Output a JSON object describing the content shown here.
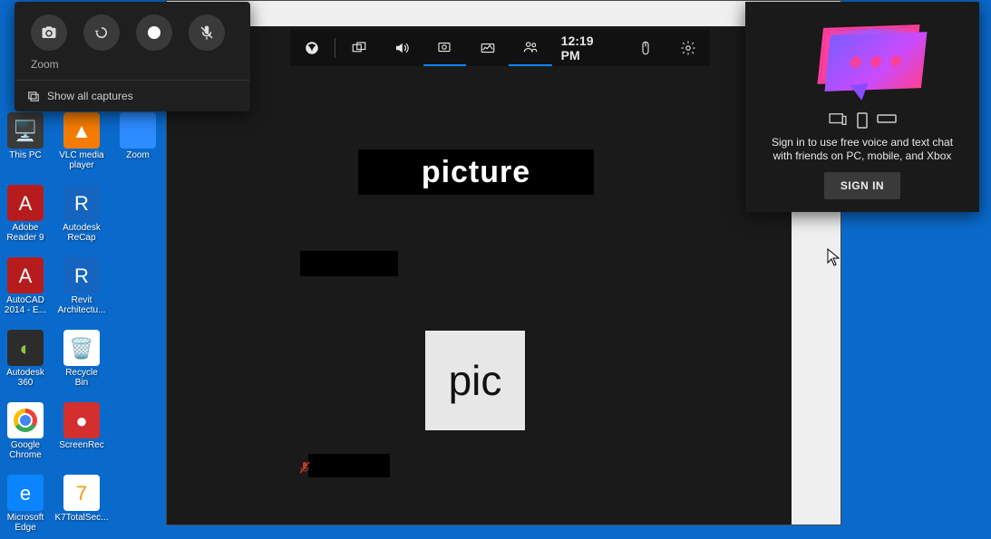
{
  "desktop": {
    "icons": [
      {
        "label": "This PC"
      },
      {
        "label": "VLC media player"
      },
      {
        "label": "Zoom"
      },
      {
        "label": "Adobe Reader 9"
      },
      {
        "label": "Autodesk ReCap"
      },
      {
        "label": "AutoCAD 2014 - E..."
      },
      {
        "label": "Revit Architectu..."
      },
      {
        "label": "Autodesk 360"
      },
      {
        "label": "Recycle Bin"
      },
      {
        "label": "Google Chrome"
      },
      {
        "label": "ScreenRec"
      },
      {
        "label": "Microsoft Edge"
      },
      {
        "label": "K7TotalSec..."
      }
    ]
  },
  "capture": {
    "title": "Zoom",
    "show_all": "Show all captures"
  },
  "gamebar": {
    "time": "12:19 PM"
  },
  "app": {
    "big_label": "picture",
    "pic_label": "pic"
  },
  "social": {
    "text_line1": "Sign in to use free voice and text chat",
    "text_line2": "with friends on PC, mobile, and Xbox",
    "button": "SIGN IN"
  }
}
